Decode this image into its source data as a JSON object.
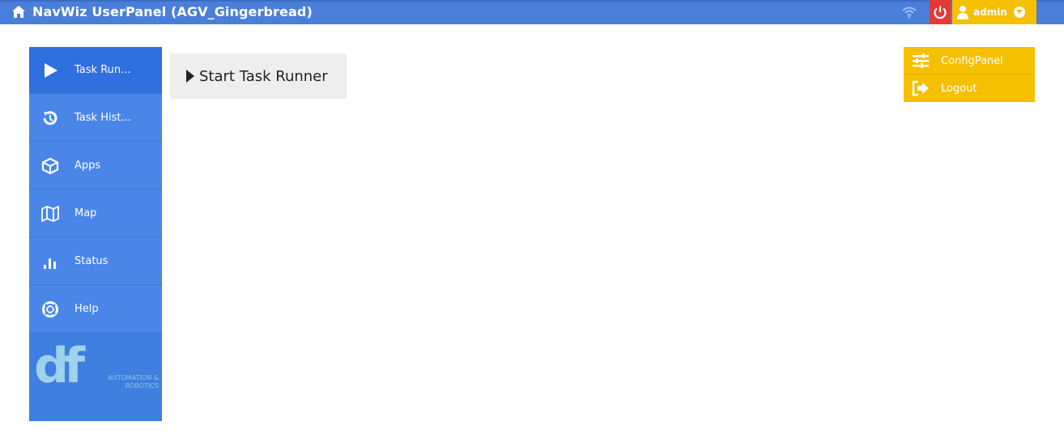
{
  "header": {
    "title": "NavWiz UserPanel (AGV_Gingerbread)",
    "user": "admin"
  },
  "sidebar": {
    "items": [
      {
        "label": "Task Run...",
        "icon": "play-icon",
        "active": true
      },
      {
        "label": "Task Hist...",
        "icon": "history-icon",
        "active": false
      },
      {
        "label": "Apps",
        "icon": "cube-icon",
        "active": false
      },
      {
        "label": "Map",
        "icon": "map-icon",
        "active": false
      },
      {
        "label": "Status",
        "icon": "bar-chart-icon",
        "active": false
      },
      {
        "label": "Help",
        "icon": "lifebuoy-icon",
        "active": false
      }
    ],
    "logo": {
      "letters": "df",
      "tagline": "AUTOMATION & ROBOTICS"
    }
  },
  "main": {
    "start_button": "Start Task Runner"
  },
  "user_menu": {
    "items": [
      {
        "label": "ConfigPanel",
        "icon": "sliders-icon"
      },
      {
        "label": "Logout",
        "icon": "logout-icon"
      }
    ]
  },
  "colors": {
    "header": "#4a7fd9",
    "sidebar": "#4a86e8",
    "sidebar_active": "#2f6fde",
    "power": "#e53935",
    "user_accent": "#f5c000"
  }
}
